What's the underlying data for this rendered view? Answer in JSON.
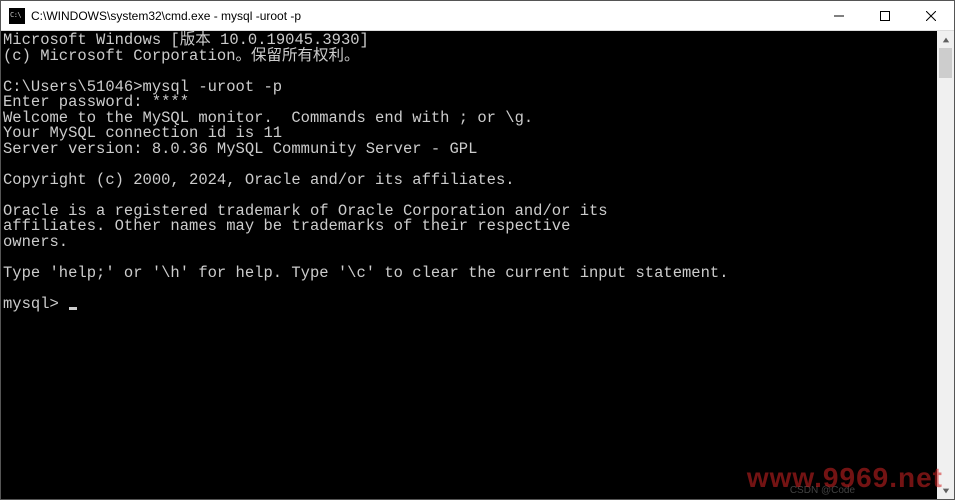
{
  "titlebar": {
    "title": "C:\\WINDOWS\\system32\\cmd.exe - mysql  -uroot -p"
  },
  "terminal": {
    "lines": [
      "Microsoft Windows [版本 10.0.19045.3930]",
      "(c) Microsoft Corporation。保留所有权利。",
      "",
      "C:\\Users\\51046>mysql -uroot -p",
      "Enter password: ****",
      "Welcome to the MySQL monitor.  Commands end with ; or \\g.",
      "Your MySQL connection id is 11",
      "Server version: 8.0.36 MySQL Community Server - GPL",
      "",
      "Copyright (c) 2000, 2024, Oracle and/or its affiliates.",
      "",
      "Oracle is a registered trademark of Oracle Corporation and/or its",
      "affiliates. Other names may be trademarks of their respective",
      "owners.",
      "",
      "Type 'help;' or '\\h' for help. Type '\\c' to clear the current input statement.",
      ""
    ],
    "prompt": "mysql> "
  },
  "watermark": {
    "right": "www.9969.net",
    "center": "CSDN @Code"
  }
}
